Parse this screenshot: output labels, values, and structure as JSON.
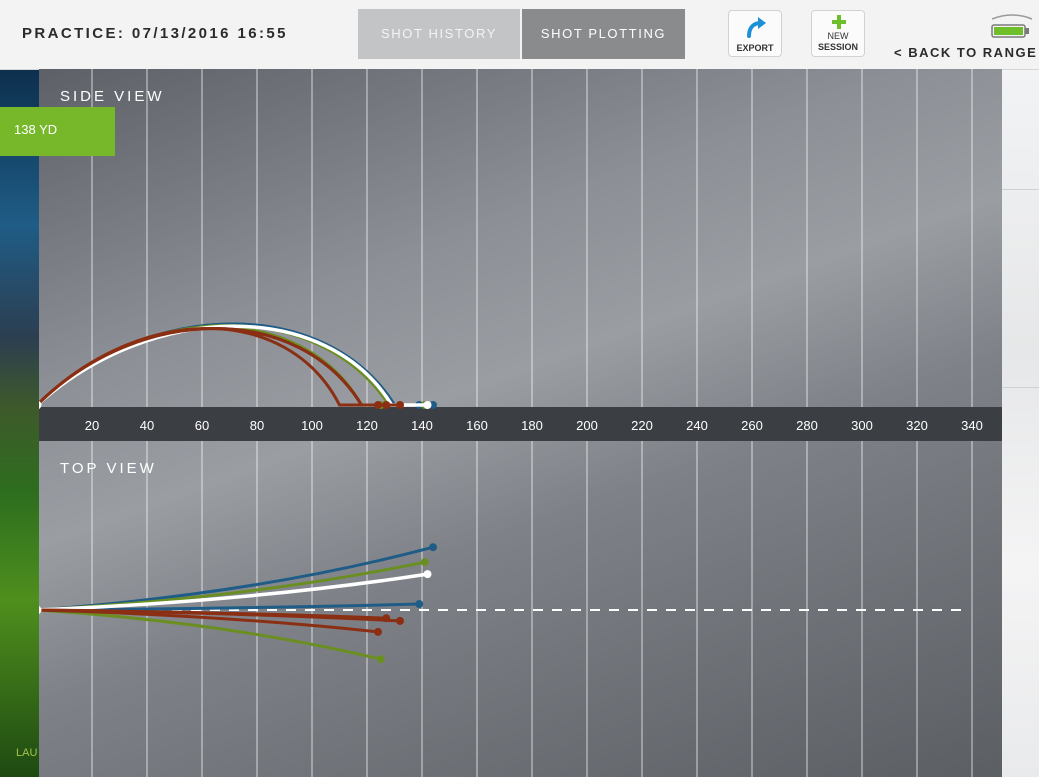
{
  "header": {
    "practice_title": "PRACTICE: 07/13/2016 16:55",
    "tabs": [
      {
        "label": "SHOT HISTORY",
        "active": false
      },
      {
        "label": "SHOT PLOTTING",
        "active": true
      }
    ],
    "export_label": "EXPORT",
    "new_session_label_line1": "NEW",
    "new_session_label_line2": "SESSION",
    "back_label": "< BACK TO RANGE",
    "icons": [
      "export-icon",
      "plus-icon",
      "battery-icon"
    ]
  },
  "badge": {
    "label": "138 YD"
  },
  "background_hint": "LAU",
  "colors": {
    "accent_green": "#76b82a",
    "shot_blue": "#1f5c86",
    "shot_green": "#6b8e23",
    "shot_brown": "#8b2f14",
    "shot_white": "#ffffff"
  },
  "side_view": {
    "label": "SIDE VIEW"
  },
  "top_view": {
    "label": "TOP VIEW"
  },
  "chart_data": {
    "type": "line",
    "xlabel": "",
    "x_ticks": [
      20,
      40,
      60,
      80,
      100,
      120,
      140,
      160,
      180,
      200,
      220,
      240,
      260,
      280,
      300,
      320,
      340
    ],
    "xlim": [
      0,
      350
    ],
    "shots": [
      {
        "color": "blue",
        "carry": 130,
        "total": 144,
        "apex": 78,
        "apex_x": 75,
        "top_end_offset": -21
      },
      {
        "color": "blue",
        "carry": 130,
        "total": 139,
        "apex": 78,
        "apex_x": 75,
        "top_end_offset": -2
      },
      {
        "color": "green",
        "carry": 128,
        "total": 141,
        "apex": 76,
        "apex_x": 72,
        "top_end_offset": -16
      },
      {
        "color": "green",
        "carry": 118,
        "total": 125,
        "apex": 74,
        "apex_x": 70,
        "top_end_offset": 18
      },
      {
        "color": "white",
        "carry": 129,
        "total": 142,
        "apex": 75,
        "apex_x": 77,
        "top_end_offset": -12
      },
      {
        "color": "brown",
        "carry": 110,
        "total": 124,
        "apex": 72,
        "apex_x": 68,
        "top_end_offset": 8
      },
      {
        "color": "brown",
        "carry": 118,
        "total": 132,
        "apex": 72,
        "apex_x": 68,
        "top_end_offset": 4
      },
      {
        "color": "brown",
        "carry": 118,
        "total": 127,
        "apex": 72,
        "apex_x": 68,
        "top_end_offset": 3
      }
    ]
  }
}
